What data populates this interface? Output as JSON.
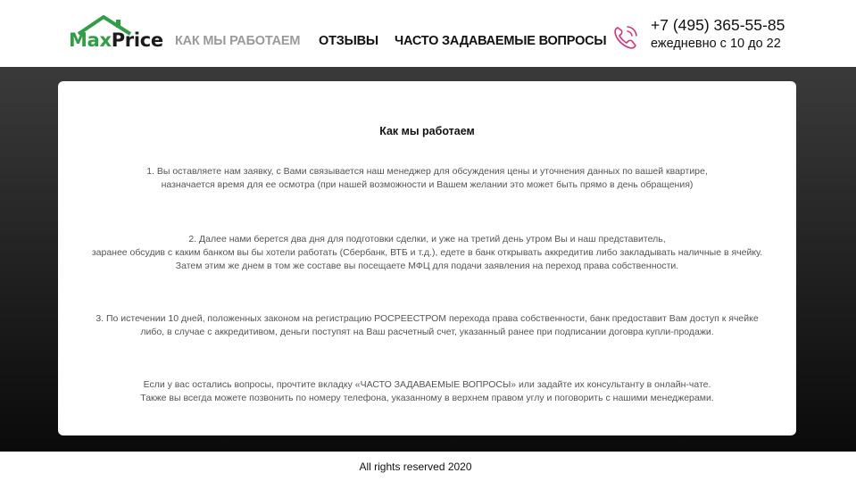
{
  "brand": {
    "logo_max": "Max",
    "logo_price": "Price",
    "accent_color": "#2f9e44",
    "phone_icon_color": "#d6317a"
  },
  "nav": {
    "items": [
      "КАК МЫ РАБОТАЕМ",
      "ОТЗЫВЫ",
      "ЧАСТО ЗАДАВАЕМЫЕ ВОПРОСЫ"
    ],
    "active_index": 0
  },
  "contact": {
    "phone": "+7 (495) 365-55-85",
    "hours": "ежедневно с 10 до 22"
  },
  "content": {
    "title": "Как мы работаем",
    "p1": [
      "1. Вы оставляете нам заявку, с Вами связывается наш менеджер для обсуждения цены и уточнения данных по вашей квартире,",
      "назначается время для ее осмотра (при нашей возможности и Вашем желании это может быть прямо в день обращения)"
    ],
    "p2": [
      "2. Далее нами берется два дня для подготовки сделки, и уже на третий день утром Вы и наш представитель,",
      "заранее обсудив с каким банком вы бы хотели работать (Сбербанк, ВТБ и т.д.), едете в банк открывать аккредитив либо закладывать наличные в ячейку.",
      "Затем этим же днем в том же составе вы посещаете МФЦ для подачи заявления на переход права собственности."
    ],
    "p3": [
      "3. По истечении 10 дней, положенных законом на регистрацию РОСРЕЕСТРОМ перехода права собственности, банк предоставит Вам доступ к ячейке",
      "либо, в случае с аккредитивом, деньги поступят на Ваш расчетный счет, указанный ранее при подписании договра купли-продажи."
    ],
    "p4": [
      "Если у вас остались вопросы, прочтите вкладку «ЧАСТО ЗАДАВАЕМЫЕ ВОПРОСЫ» или задайте их консультанту в онлайн-чате.",
      "Также вы всегда можете позвонить по номеру телефона, указанному в верхнем правом углу и поговорить с нашими менеджерами."
    ]
  },
  "footer": {
    "copyright": "All rights reserved 2020"
  }
}
